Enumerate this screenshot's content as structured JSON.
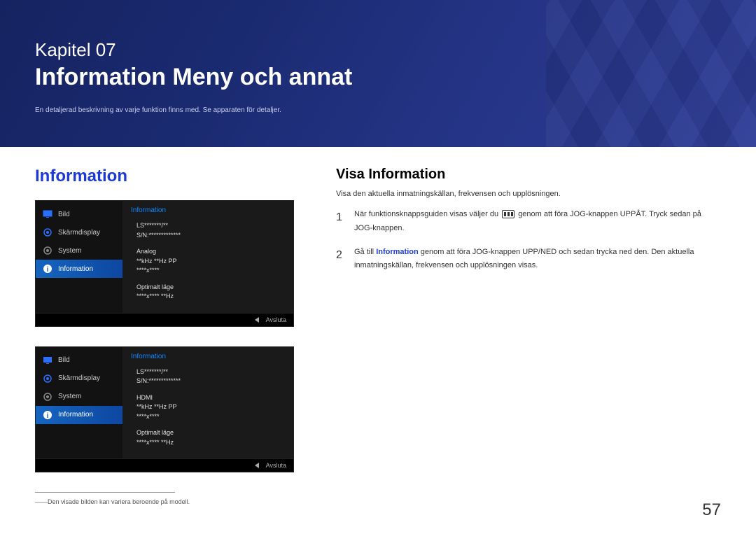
{
  "chapter": {
    "label": "Kapitel 07",
    "title": "Information Meny och annat",
    "desc": "En detaljerad beskrivning av varje funktion finns med. Se apparaten för detaljer."
  },
  "section_heading": "Information",
  "osd": {
    "panel_title": "Information",
    "menu": {
      "bild": "Bild",
      "skarm": "Skärmdisplay",
      "system": "System",
      "info": "Information"
    },
    "lines1": {
      "l1": "LS*******/**",
      "l2": "S/N:*************",
      "src": "Analog",
      "freq": "**kHz **Hz PP",
      "res": "****x****",
      "opt": "Optimalt läge",
      "optres": "****x**** **Hz"
    },
    "lines2": {
      "l1": "LS*******/**",
      "l2": "S/N:*************",
      "src": "HDMI",
      "freq": "**kHz **Hz PP",
      "res": "****x****",
      "opt": "Optimalt läge",
      "optres": "****x**** **Hz"
    },
    "exit": "Avsluta"
  },
  "footnote": "――Den visade bilden kan variera beroende på modell.",
  "right": {
    "heading": "Visa Information",
    "desc": "Visa den aktuella inmatningskällan, frekvensen och upplösningen.",
    "step1": {
      "num": "1",
      "a": "När funktionsknappsguiden visas väljer du ",
      "b": " genom att föra JOG-knappen UPPÅT. Tryck sedan på JOG-knappen."
    },
    "step2": {
      "num": "2",
      "a": "Gå till ",
      "hl": "Information",
      "b": " genom att föra JOG-knappen UPP/NED och sedan trycka ned den. Den aktuella inmatningskällan, frekvensen och upplösningen visas."
    }
  },
  "page_number": "57"
}
